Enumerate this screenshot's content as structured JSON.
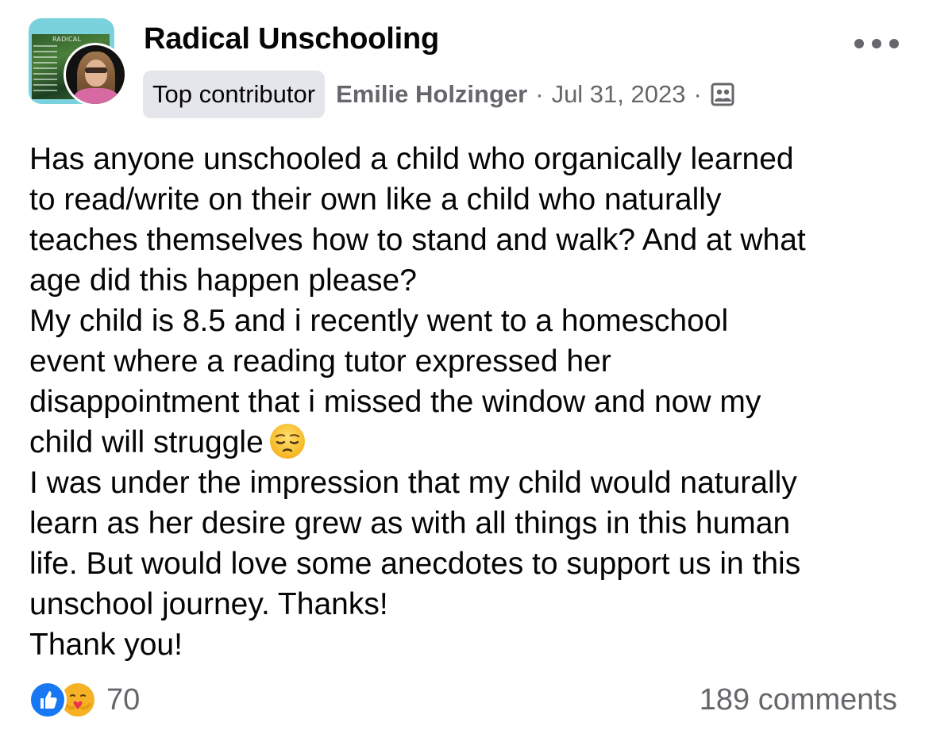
{
  "post": {
    "group_name": "Radical Unschooling",
    "group_avatar_text": "RADICAL",
    "badge": "Top contributor",
    "author": "Emilie Holzinger",
    "separator": "·",
    "date": "Jul 31, 2023",
    "privacy_icon": "members-icon",
    "body_lines": [
      "Has anyone unschooled a child who organically learned",
      "to read/write on their own like a child who naturally",
      "teaches themselves how to stand and walk? And at what",
      "age did this happen please?",
      "My child is 8.5 and i recently went to a homeschool",
      "event where a reading tutor expressed her",
      "disappointment that i missed the window and now my",
      "child will struggle",
      "I was under the impression that my child would naturally",
      "learn as her desire grew as with all things in this human",
      "life. But would love some anecdotes to support us in this",
      "unschool journey. Thanks!",
      "Thank you!"
    ],
    "emoji": "pensive-face-emoji"
  },
  "footer": {
    "reaction_icons": [
      "like-icon",
      "care-icon"
    ],
    "reaction_count": "70",
    "comments": "189 comments"
  },
  "colors": {
    "text": "#050505",
    "secondary": "#65676b",
    "badge_bg": "#e4e6eb",
    "like_blue": "#1877f2",
    "care_yellow": "#f7b125"
  }
}
